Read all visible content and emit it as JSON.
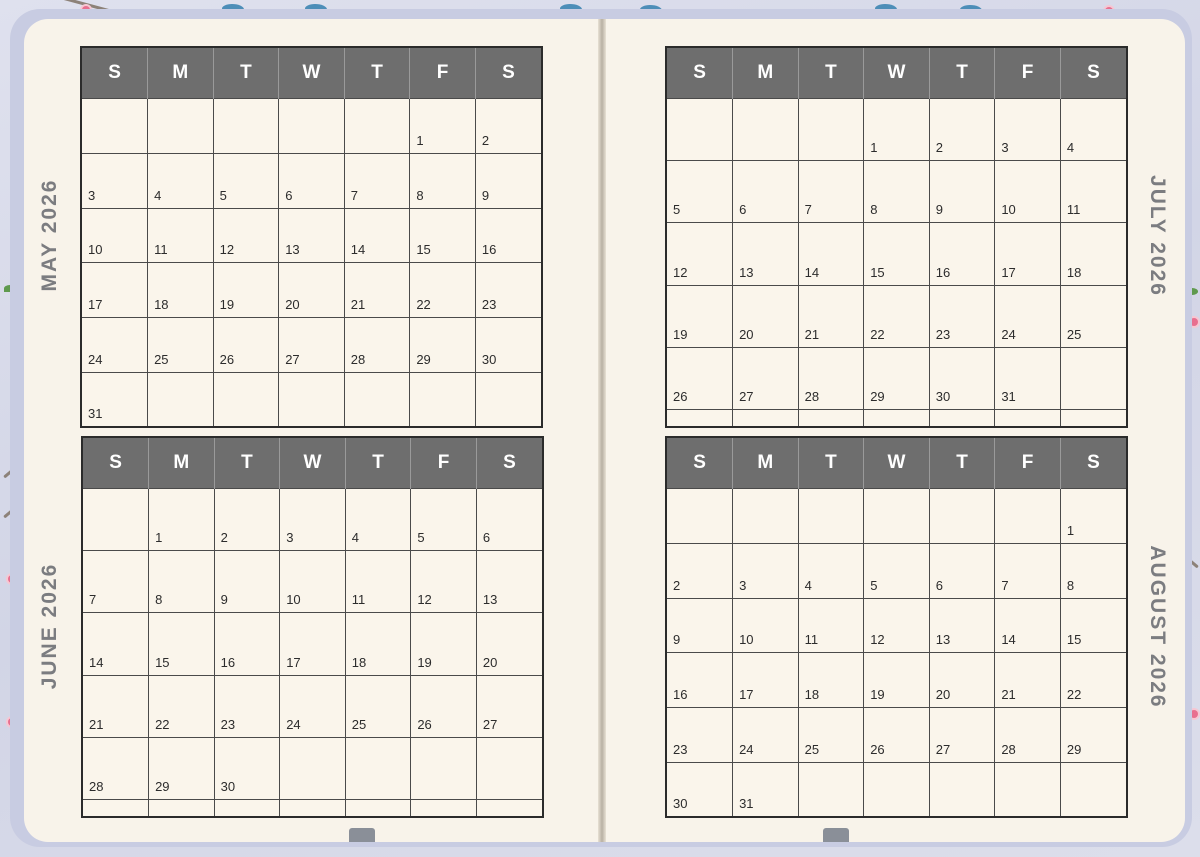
{
  "weekdays": [
    "S",
    "M",
    "T",
    "W",
    "T",
    "F",
    "S"
  ],
  "months": [
    {
      "id": "may",
      "title": "MAY 2026",
      "weeks": [
        [
          "",
          "",
          "",
          "",
          "",
          "1",
          "2"
        ],
        [
          "3",
          "4",
          "5",
          "6",
          "7",
          "8",
          "9"
        ],
        [
          "10",
          "11",
          "12",
          "13",
          "14",
          "15",
          "16"
        ],
        [
          "17",
          "18",
          "19",
          "20",
          "21",
          "22",
          "23"
        ],
        [
          "24",
          "25",
          "26",
          "27",
          "28",
          "29",
          "30"
        ],
        [
          "31",
          "",
          "",
          "",
          "",
          "",
          ""
        ]
      ]
    },
    {
      "id": "june",
      "title": "JUNE 2026",
      "weeks": [
        [
          "",
          "1",
          "2",
          "3",
          "4",
          "5",
          "6"
        ],
        [
          "7",
          "8",
          "9",
          "10",
          "11",
          "12",
          "13"
        ],
        [
          "14",
          "15",
          "16",
          "17",
          "18",
          "19",
          "20"
        ],
        [
          "21",
          "22",
          "23",
          "24",
          "25",
          "26",
          "27"
        ],
        [
          "28",
          "29",
          "30",
          "",
          "",
          "",
          ""
        ],
        [
          "",
          "",
          "",
          "",
          "",
          "",
          ""
        ]
      ]
    },
    {
      "id": "july",
      "title": "JULY 2026",
      "weeks": [
        [
          "",
          "",
          "",
          "1",
          "2",
          "3",
          "4"
        ],
        [
          "5",
          "6",
          "7",
          "8",
          "9",
          "10",
          "11"
        ],
        [
          "12",
          "13",
          "14",
          "15",
          "16",
          "17",
          "18"
        ],
        [
          "19",
          "20",
          "21",
          "22",
          "23",
          "24",
          "25"
        ],
        [
          "26",
          "27",
          "28",
          "29",
          "30",
          "31",
          ""
        ],
        [
          "",
          "",
          "",
          "",
          "",
          "",
          ""
        ]
      ]
    },
    {
      "id": "august",
      "title": "AUGUST 2026",
      "weeks": [
        [
          "",
          "",
          "",
          "",
          "",
          "",
          "1"
        ],
        [
          "2",
          "3",
          "4",
          "5",
          "6",
          "7",
          "8"
        ],
        [
          "9",
          "10",
          "11",
          "12",
          "13",
          "14",
          "15"
        ],
        [
          "16",
          "17",
          "18",
          "19",
          "20",
          "21",
          "22"
        ],
        [
          "23",
          "24",
          "25",
          "26",
          "27",
          "28",
          "29"
        ],
        [
          "30",
          "31",
          "",
          "",
          "",
          "",
          ""
        ]
      ]
    }
  ],
  "colors": {
    "header_bg": "#6e6e6e",
    "header_text": "#ffffff",
    "page_bg": "#f8f3ea",
    "cover_bg": "#c8cce2",
    "month_label": "#7b7c80",
    "grid_line": "#2b2b2b"
  }
}
